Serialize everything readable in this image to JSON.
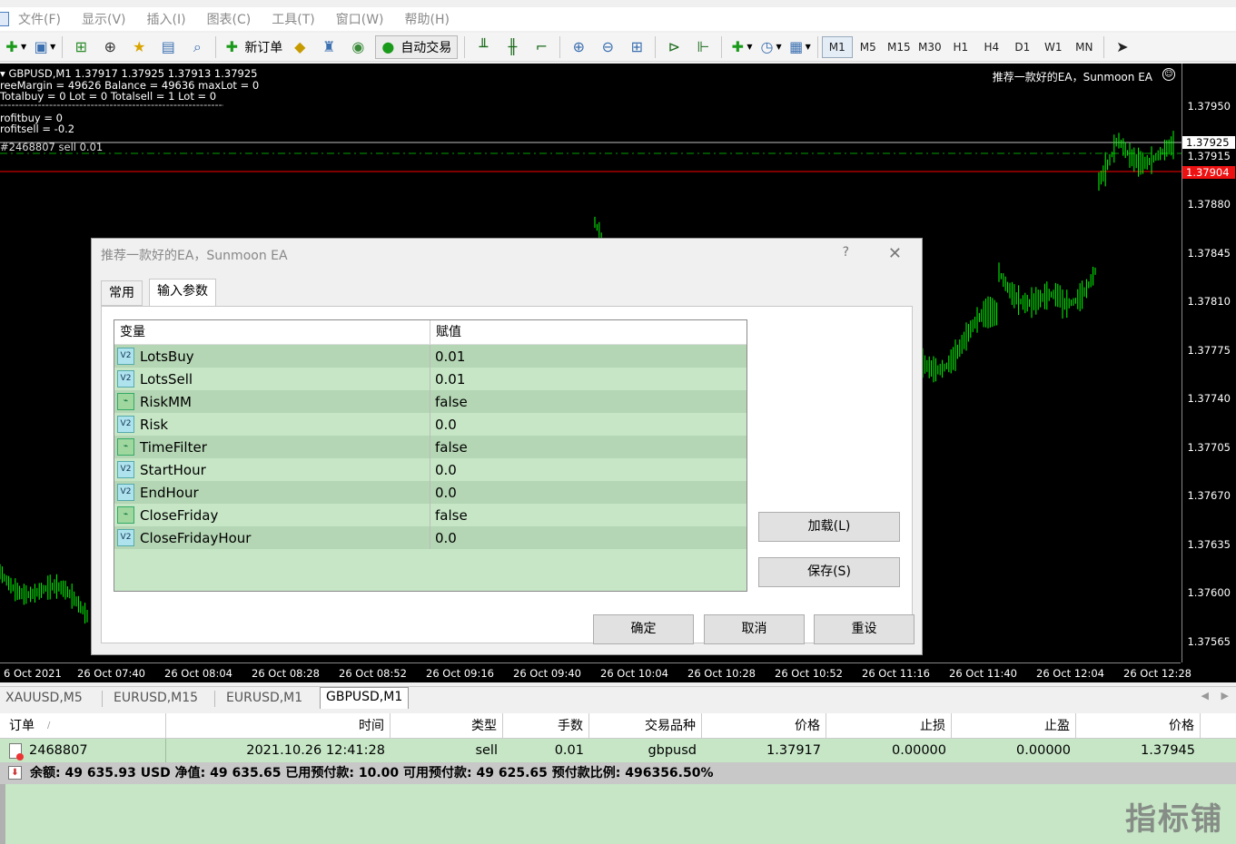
{
  "menu": {
    "items": [
      "文件(F)",
      "显示(V)",
      "插入(I)",
      "图表(C)",
      "工具(T)",
      "窗口(W)",
      "帮助(H)"
    ]
  },
  "toolbar": {
    "new_order_label": "新订单",
    "auto_trade_label": "自动交易",
    "timeframes": [
      "M1",
      "M5",
      "M15",
      "M30",
      "H1",
      "H4",
      "D1",
      "W1",
      "MN"
    ],
    "active_timeframe": "M1"
  },
  "chart": {
    "info_lines": [
      "GBPUSD,M1  1.37917 1.37925 1.37913 1.37925",
      "reeMargin = 49626  Balance = 49636  maxLot = 0",
      "Totalbuy = 0  Lot = 0  Totalsell = 1  Lot = 0",
      "rofitbuy = 0",
      "rofitsell = -0.2"
    ],
    "separator_line": "-----------------------------------------------------------------------",
    "order_line_label": "#2468807 sell 0.01",
    "ea_label": "推荐一款好的EA，Sunmoon EA",
    "price_labels": [
      "1.37950",
      "1.37915",
      "1.37880",
      "1.37845",
      "1.37810",
      "1.37775",
      "1.37740",
      "1.37705",
      "1.37670",
      "1.37635",
      "1.37600",
      "1.37565"
    ],
    "bid_price": "1.37925",
    "ask_price": "1.37904",
    "time_labels": [
      "6 Oct 2021",
      "26 Oct 07:40",
      "26 Oct 08:04",
      "26 Oct 08:28",
      "26 Oct 08:52",
      "26 Oct 09:16",
      "26 Oct 09:40",
      "26 Oct 10:04",
      "26 Oct 10:28",
      "26 Oct 10:52",
      "26 Oct 11:16",
      "26 Oct 11:40",
      "26 Oct 12:04",
      "26 Oct 12:28"
    ],
    "colors": {
      "candle": "#00ff00",
      "bid_line": "#c0c0c0",
      "ask_line": "#ff0000",
      "order_line": "#00a000"
    }
  },
  "dialog": {
    "title": "推荐一款好的EA，Sunmoon EA",
    "help": "?",
    "tabs": [
      "常用",
      "输入参数"
    ],
    "active_tab": "输入参数",
    "columns": [
      "变量",
      "赋值"
    ],
    "params": [
      {
        "name": "LotsBuy",
        "value": "0.01",
        "icon": "v2"
      },
      {
        "name": "LotsSell",
        "value": "0.01",
        "icon": "v2"
      },
      {
        "name": "RiskMM",
        "value": "false",
        "icon": "bool"
      },
      {
        "name": "Risk",
        "value": "0.0",
        "icon": "v2"
      },
      {
        "name": "TimeFilter",
        "value": "false",
        "icon": "bool"
      },
      {
        "name": "StartHour",
        "value": "0.0",
        "icon": "v2"
      },
      {
        "name": "EndHour",
        "value": "0.0",
        "icon": "v2"
      },
      {
        "name": "CloseFriday",
        "value": "false",
        "icon": "bool"
      },
      {
        "name": "CloseFridayHour",
        "value": "0.0",
        "icon": "v2"
      }
    ],
    "load_label": "加载(L)",
    "save_label": "保存(S)",
    "ok_label": "确定",
    "cancel_label": "取消",
    "reset_label": "重设"
  },
  "symbol_tabs": [
    "XAUUSD,M5",
    "EURUSD,M15",
    "EURUSD,M1",
    "GBPUSD,M1"
  ],
  "active_symbol_tab": "GBPUSD,M1",
  "terminal": {
    "headers": [
      "订单",
      "/",
      "时间",
      "类型",
      "手数",
      "交易品种",
      "价格",
      "止损",
      "止盈",
      "价格"
    ],
    "order": {
      "ticket": "2468807",
      "time": "2021.10.26 12:41:28",
      "type": "sell",
      "lots": "0.01",
      "symbol": "gbpusd",
      "price": "1.37917",
      "sl": "0.00000",
      "tp": "0.00000",
      "current_price": "1.37945"
    },
    "summary": "余额: 49 635.93 USD  净值: 49 635.65  已用预付款: 10.00  可用预付款: 49 625.65  预付款比例: 496356.50%"
  },
  "watermark": "指标铺"
}
